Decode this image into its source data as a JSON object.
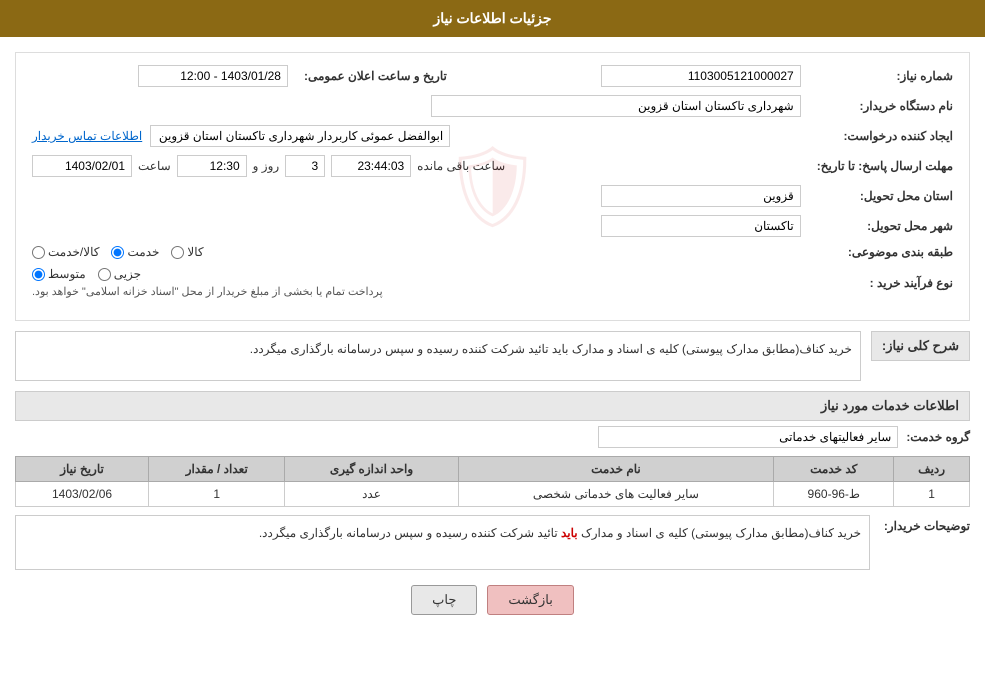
{
  "header": {
    "title": "جزئیات اطلاعات نیاز"
  },
  "fields": {
    "need_number_label": "شماره نیاز:",
    "need_number_value": "1103005121000027",
    "org_name_label": "نام دستگاه خریدار:",
    "org_name_value": "شهرداری تاکستان استان قزوین",
    "creator_label": "ایجاد کننده درخواست:",
    "creator_value": "ابوالفضل عموئی کاربردار شهرداری تاکستان استان قزوین",
    "contact_link": "اطلاعات تماس خریدار",
    "deadline_label": "مهلت ارسال پاسخ: تا تاریخ:",
    "date_value": "1403/02/01",
    "time_label": "ساعت",
    "time_value": "12:30",
    "days_label": "روز و",
    "days_value": "3",
    "remaining_label": "ساعت باقی مانده",
    "remaining_value": "23:44:03",
    "announce_label": "تاریخ و ساعت اعلان عمومی:",
    "announce_value": "1403/01/28 - 12:00",
    "province_label": "استان محل تحویل:",
    "province_value": "قزوین",
    "city_label": "شهر محل تحویل:",
    "city_value": "تاکستان",
    "category_label": "طبقه بندی موضوعی:",
    "category_options": [
      {
        "label": "کالا",
        "value": "kala"
      },
      {
        "label": "خدمت",
        "value": "khadamat"
      },
      {
        "label": "کالا/خدمت",
        "value": "kala_khadamat"
      }
    ],
    "category_selected": "khadamat",
    "process_label": "نوع فرآیند خرید :",
    "process_options": [
      {
        "label": "جزیی",
        "value": "jozyi"
      },
      {
        "label": "متوسط",
        "value": "motavaset"
      }
    ],
    "process_selected": "motavaset",
    "process_note": "پرداخت تمام یا بخشی از مبلغ خریدار از محل \"اسناد خزانه اسلامی\" خواهد بود.",
    "need_description_label": "شرح کلی نیاز:",
    "need_description": "خرید کناف(مطابق مدارک پیوستی) کلیه ی اسناد و مدارک باید تائید شرکت کننده رسیده و سپس درسامانه بارگذاری میگردد.",
    "services_title": "اطلاعات خدمات مورد نیاز",
    "service_group_label": "گروه خدمت:",
    "service_group_value": "سایر فعالیتهای خدماتی",
    "table": {
      "headers": [
        "ردیف",
        "کد خدمت",
        "نام خدمت",
        "واحد اندازه گیری",
        "تعداد / مقدار",
        "تاریخ نیاز"
      ],
      "rows": [
        {
          "row": "1",
          "code": "ط-96-960",
          "name": "سایر فعالیت های خدماتی شخصی",
          "unit": "عدد",
          "quantity": "1",
          "date": "1403/02/06"
        }
      ]
    },
    "buyer_desc_label": "توضیحات خریدار:",
    "buyer_desc_text_1": "خرید کناف(مطابق مدارک پیوستی) کلیه ی اسناد و مدارک ",
    "buyer_desc_highlight": "باید",
    "buyer_desc_text_2": " تائید شرکت کننده رسیده و سپس درسامانه بارگذاری میگردد."
  },
  "buttons": {
    "print_label": "چاپ",
    "back_label": "بازگشت"
  }
}
